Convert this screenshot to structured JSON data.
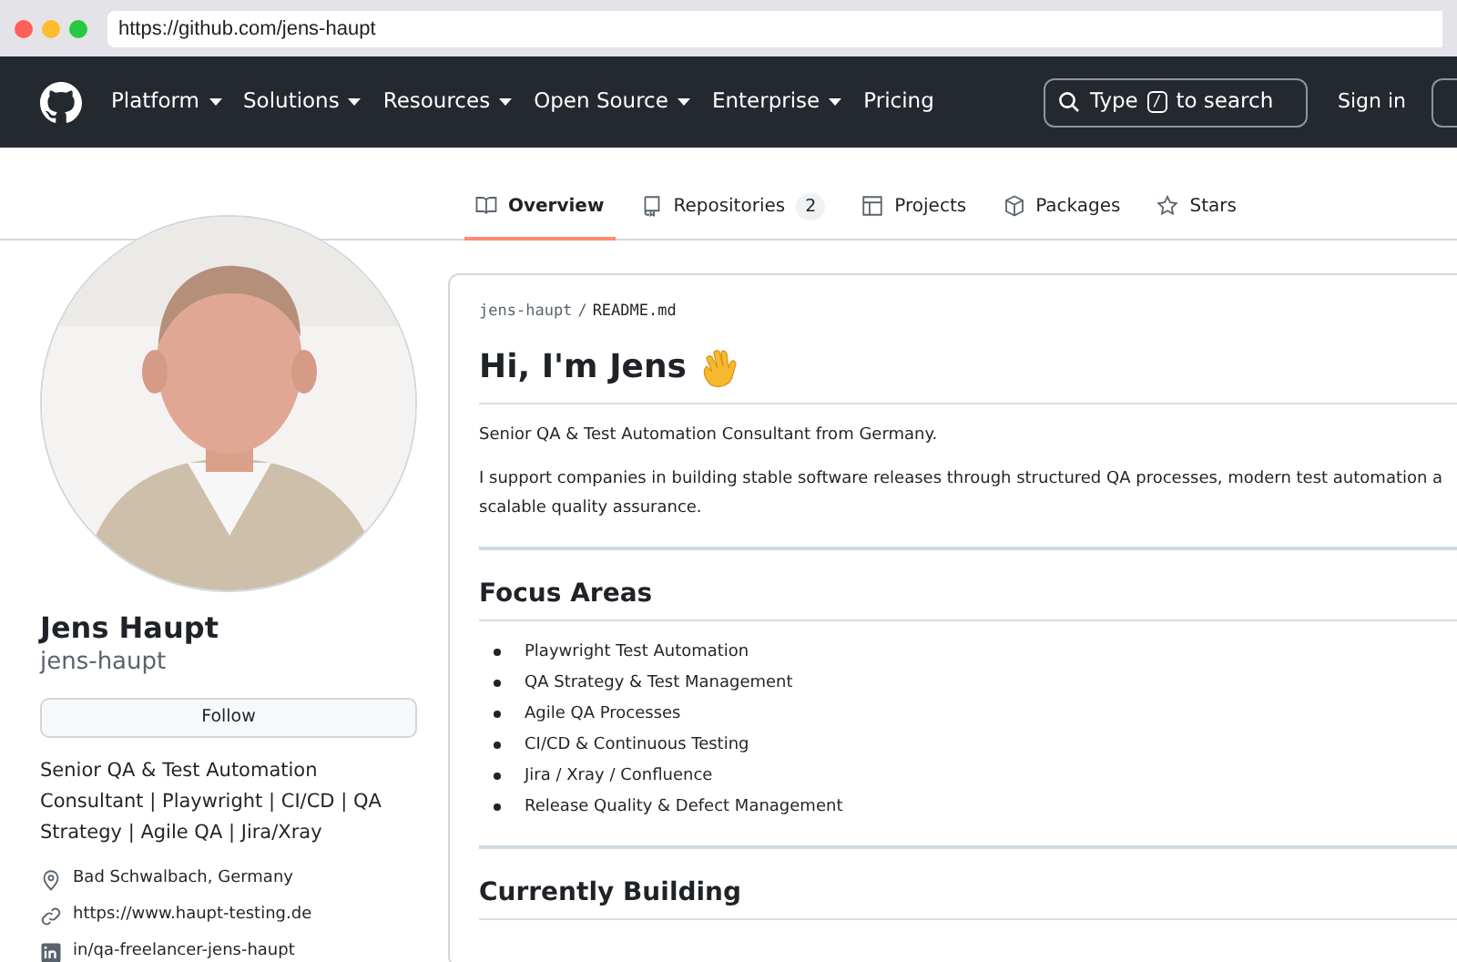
{
  "browser": {
    "url": "https://github.com/jens-haupt"
  },
  "nav": {
    "items": [
      {
        "label": "Platform",
        "dropdown": true
      },
      {
        "label": "Solutions",
        "dropdown": true
      },
      {
        "label": "Resources",
        "dropdown": true
      },
      {
        "label": "Open Source",
        "dropdown": true
      },
      {
        "label": "Enterprise",
        "dropdown": true
      },
      {
        "label": "Pricing",
        "dropdown": false
      }
    ],
    "search": {
      "before": "Type",
      "key": "/",
      "after": "to search"
    },
    "sign_in": "Sign in"
  },
  "tabs": [
    {
      "label": "Overview",
      "selected": true
    },
    {
      "label": "Repositories",
      "count": "2",
      "selected": false
    },
    {
      "label": "Projects",
      "selected": false
    },
    {
      "label": "Packages",
      "selected": false
    },
    {
      "label": "Stars",
      "selected": false
    }
  ],
  "profile": {
    "name": "Jens Haupt",
    "login": "jens-haupt",
    "follow": "Follow",
    "bio": "Senior QA & Test Automation Consultant | Playwright | CI/CD | QA Strategy | Agile QA | Jira/Xray",
    "details": [
      {
        "kind": "location",
        "text": "Bad Schwalbach, Germany"
      },
      {
        "kind": "link",
        "text": "https://www.haupt-testing.de"
      },
      {
        "kind": "linkedin",
        "text": "in/qa-freelancer-jens-haupt"
      }
    ]
  },
  "readme": {
    "path_owner": "jens-haupt",
    "path_separator": "/",
    "path_file": "README.md",
    "title": "Hi, I'm Jens",
    "paragraphs": [
      [
        "Senior QA & Test Automation Consultant from Germany."
      ],
      [
        "I support companies in building stable software releases through structured QA processes, modern test automation a",
        "scalable quality assurance."
      ]
    ],
    "sections": [
      {
        "heading": "Focus Areas",
        "items": [
          "Playwright Test Automation",
          "QA Strategy & Test Management",
          "Agile QA Processes",
          "CI/CD & Continuous Testing",
          "Jira / Xray / Confluence",
          "Release Quality & Defect Management"
        ]
      },
      {
        "heading": "Currently Building"
      }
    ]
  }
}
